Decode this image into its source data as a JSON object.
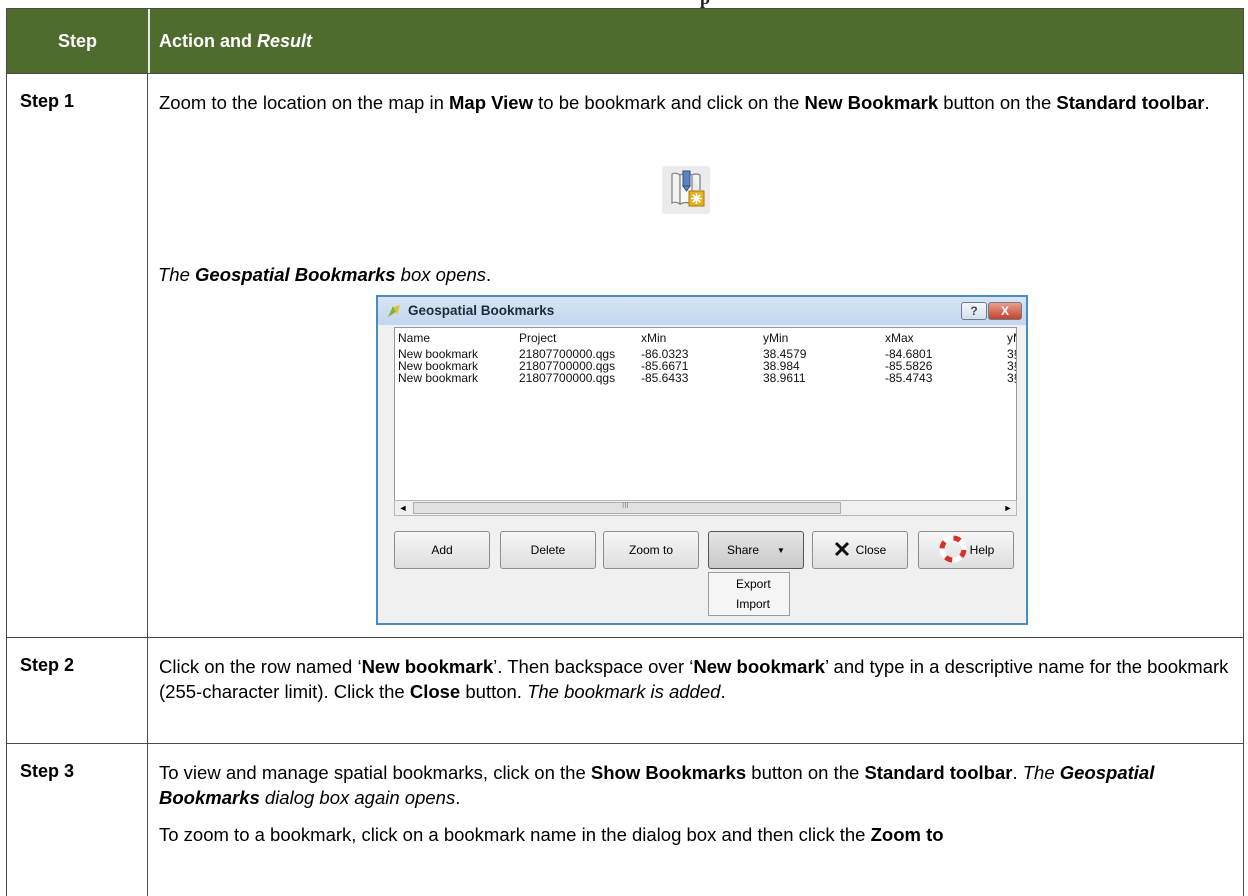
{
  "table": {
    "headers": {
      "step": "Step",
      "action_prefix": "Action and ",
      "action_suffix": "Result"
    },
    "rows": [
      {
        "label": "Step 1",
        "intro": [
          "Zoom to the location on the map in ",
          "Map View",
          " to be bookmark and click on the ",
          "New Bookmark",
          " button on the ",
          "Standard toolbar",
          "."
        ],
        "toolbar_icon": "new-bookmark-icon",
        "result": [
          "The ",
          "Geospatial Bookmarks",
          " box opens",
          "."
        ]
      },
      {
        "label": "Step 2",
        "text": [
          "Click on the row named ‘",
          "New bookmark",
          "’. Then backspace over ‘",
          "New bookmark",
          "’ and type in a descriptive name for the bookmark (255-character limit). Click the ",
          "Close",
          " button. ",
          "The bookmark is added",
          "."
        ]
      },
      {
        "label": "Step 3",
        "p1": [
          "To view and manage spatial bookmarks, click on the ",
          "Show Bookmarks",
          " button on the ",
          "Standard toolbar",
          ". ",
          "The ",
          "Geospatial Bookmarks",
          " dialog box again opens",
          "."
        ],
        "p2": [
          "To zoom to a bookmark, click on a bookmark name in the dialog box and then click the ",
          "Zoom to"
        ]
      }
    ]
  },
  "dialog": {
    "title": "Geospatial Bookmarks",
    "window_help": "?",
    "window_close": "X",
    "columns": [
      "Name",
      "Project",
      "xMin",
      "yMin",
      "xMax",
      "yM"
    ],
    "rows": [
      [
        "New bookmark",
        "21807700000.qgs",
        "-86.0323",
        "38.4579",
        "-84.6801",
        "3§"
      ],
      [
        "New bookmark",
        "21807700000.qgs",
        "-85.6671",
        "38.984",
        "-85.5826",
        "3§"
      ],
      [
        "New bookmark",
        "21807700000.qgs",
        "-85.6433",
        "38.9611",
        "-85.4743",
        "3§"
      ]
    ],
    "scroll_left": "◄",
    "scroll_right": "►",
    "scroll_grip": "III",
    "buttons": {
      "add": "Add",
      "delete": "Delete",
      "zoom_to": "Zoom to",
      "share": "Share",
      "close": "Close",
      "help": "Help"
    },
    "share_menu": [
      "Export",
      "Import"
    ]
  }
}
